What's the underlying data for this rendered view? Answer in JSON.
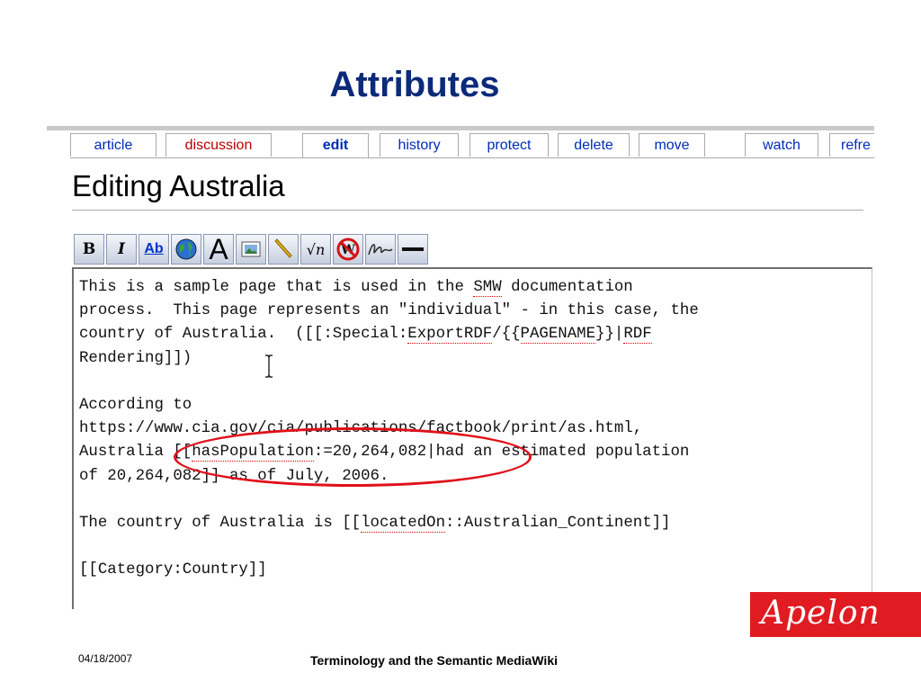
{
  "slide": {
    "title": "Attributes"
  },
  "tabs": [
    {
      "label": "article"
    },
    {
      "label": "discussion"
    },
    {
      "label": "edit"
    },
    {
      "label": "history"
    },
    {
      "label": "protect"
    },
    {
      "label": "delete"
    },
    {
      "label": "move"
    },
    {
      "label": "watch"
    },
    {
      "label": "refre"
    }
  ],
  "page": {
    "heading": "Editing Australia"
  },
  "toolbar": {
    "buttons": [
      {
        "icon": "bold-icon",
        "label": "B"
      },
      {
        "icon": "italic-icon",
        "label": "I"
      },
      {
        "icon": "internal-link-icon",
        "label": "Ab"
      },
      {
        "icon": "external-link-icon",
        "label": ""
      },
      {
        "icon": "headline-icon",
        "label": "A"
      },
      {
        "icon": "embedded-image-icon",
        "label": ""
      },
      {
        "icon": "media-file-link-icon",
        "label": ""
      },
      {
        "icon": "math-formula-icon",
        "label": "√n"
      },
      {
        "icon": "nowiki-icon",
        "label": "W"
      },
      {
        "icon": "signature-icon",
        "label": ""
      },
      {
        "icon": "horizontal-line-icon",
        "label": ""
      }
    ]
  },
  "editor": {
    "lines": [
      "This is a sample page that is used in the SMW documentation",
      "process.  This page represents an \"individual\" - in this case, the",
      "country of Australia.  ([[:Special:ExportRDF/{{PAGENAME}}|RDF",
      "Rendering]])",
      "",
      "According to",
      "https://www.cia.gov/cia/publications/factbook/print/as.html,",
      "Australia [[hasPopulation:=20,264,082|had an estimated population",
      "of 20,264,082]] as of July, 2006.",
      "",
      "The country of Australia is [[locatedOn::Australian_Continent]]",
      "",
      "[[Category:Country]]"
    ]
  },
  "footer": {
    "date": "04/18/2007",
    "title": "Terminology and the Semantic MediaWiki",
    "logo": "Apelon"
  },
  "colors": {
    "title": "#0b2a7a",
    "link": "#002bb8",
    "red_link": "#ba0000",
    "highlight": "#e0101a",
    "logo_bg": "#e01b22"
  }
}
